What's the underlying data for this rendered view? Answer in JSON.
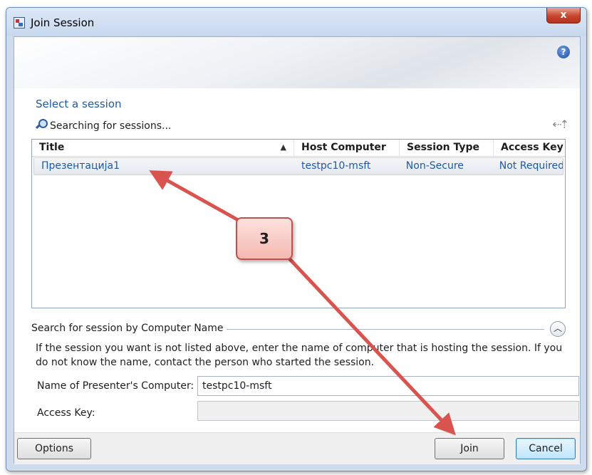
{
  "window": {
    "title": "Join Session",
    "close_glyph": "x"
  },
  "help_glyph": "?",
  "section_title": "Select a session",
  "search_status": "Searching for sessions...",
  "sessions": {
    "columns": [
      "Title",
      "Host Computer",
      "Session Type",
      "Access Key"
    ],
    "sort_indicator": "▲",
    "rows": [
      {
        "title": "Презентација1",
        "host": "testpc10-msft",
        "type": "Non-Secure",
        "access_key": "Not Required"
      }
    ]
  },
  "search_by_name": {
    "group_label": "Search for session by Computer Name",
    "help_text": "If the session you want is not listed above, enter the name of computer that is hosting the session. If you do not know the name, contact the person who started the session.",
    "presenter_label": "Name of Presenter's Computer:",
    "presenter_value": "testpc10-msft",
    "access_key_label": "Access Key:",
    "access_key_value": ""
  },
  "buttons": {
    "options": "Options",
    "join": "Join",
    "cancel": "Cancel"
  },
  "annotation": {
    "step": "3",
    "color": "#d9534f"
  }
}
